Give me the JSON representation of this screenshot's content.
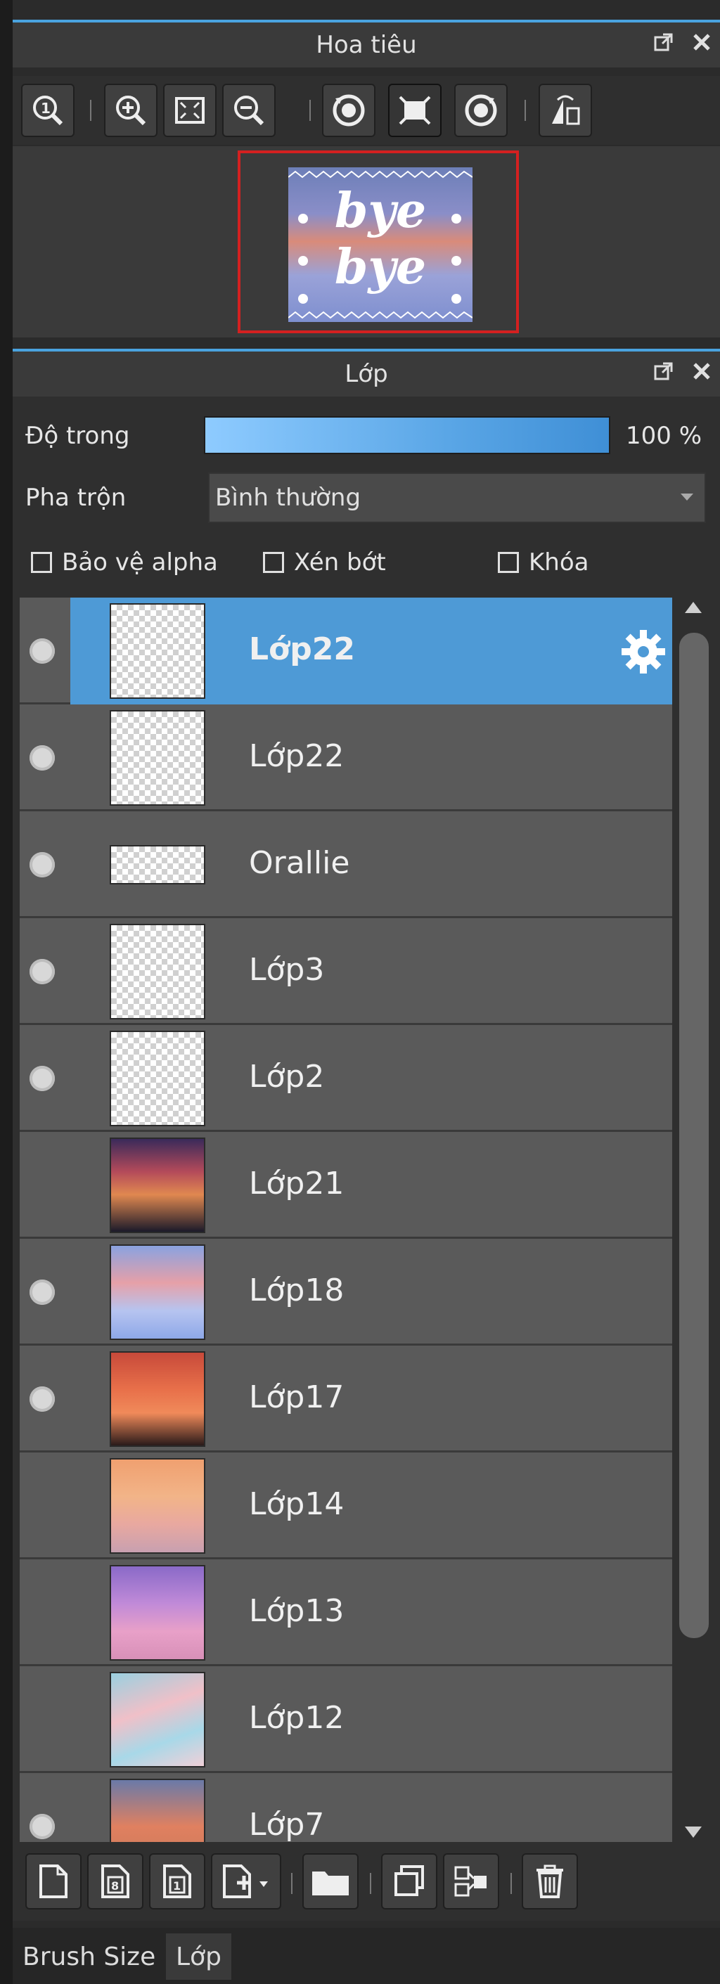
{
  "navigator": {
    "title": "Hoa tiêu",
    "toolbar": [
      {
        "icon": "zoom-actual-icon"
      },
      {
        "icon": "zoom-in-icon"
      },
      {
        "icon": "fit-screen-icon"
      },
      {
        "icon": "zoom-out-icon"
      },
      {
        "icon": "rotate-left-icon"
      },
      {
        "icon": "reset-view-icon"
      },
      {
        "icon": "rotate-right-icon"
      },
      {
        "icon": "flip-horizontal-icon"
      }
    ],
    "preview_text": "bye bye"
  },
  "layer_panel": {
    "title": "Lớp",
    "opacity_label": "Độ trong",
    "opacity_value": "100 %",
    "opacity_fraction": 1.0,
    "blend_label": "Pha trộn",
    "blend_value": "Bình thường",
    "checkboxes": [
      {
        "label": "Bảo vệ alpha",
        "checked": false
      },
      {
        "label": "Xén bớt",
        "checked": false
      },
      {
        "label": "Khóa",
        "checked": false
      }
    ],
    "layers": [
      {
        "name": "Lớp22",
        "visible": true,
        "selected": true,
        "thumb": "checker-text"
      },
      {
        "name": "Lớp22",
        "visible": true,
        "selected": false,
        "thumb": "checker-text"
      },
      {
        "name": "Orallie",
        "visible": true,
        "selected": false,
        "thumb": "checker-strip"
      },
      {
        "name": "Lớp3",
        "visible": true,
        "selected": false,
        "thumb": "checker"
      },
      {
        "name": "Lớp2",
        "visible": true,
        "selected": false,
        "thumb": "checker"
      },
      {
        "name": "Lớp21",
        "visible": false,
        "selected": false,
        "thumb": "sunset-dark"
      },
      {
        "name": "Lớp18",
        "visible": true,
        "selected": false,
        "thumb": "sky-blue"
      },
      {
        "name": "Lớp17",
        "visible": true,
        "selected": false,
        "thumb": "sky-red"
      },
      {
        "name": "Lớp14",
        "visible": false,
        "selected": false,
        "thumb": "sky-orange"
      },
      {
        "name": "Lớp13",
        "visible": false,
        "selected": false,
        "thumb": "sky-purple"
      },
      {
        "name": "Lớp12",
        "visible": false,
        "selected": false,
        "thumb": "sky-teal"
      },
      {
        "name": "Lớp7",
        "visible": true,
        "selected": false,
        "thumb": "sky-cloud"
      }
    ],
    "bottom_toolbar": [
      {
        "icon": "new-layer-icon"
      },
      {
        "icon": "new-8bit-layer-icon"
      },
      {
        "icon": "new-1bit-layer-icon"
      },
      {
        "icon": "add-layer-menu-icon"
      },
      {
        "icon": "new-folder-icon"
      },
      {
        "icon": "duplicate-layer-icon"
      },
      {
        "icon": "merge-down-icon"
      },
      {
        "icon": "delete-layer-icon"
      }
    ]
  },
  "tabs": [
    {
      "label": "Brush Size",
      "active": false
    },
    {
      "label": "Lớp",
      "active": true
    }
  ],
  "colors": {
    "accent": "#4aa3df",
    "selected_row": "#4e9ad6",
    "frame_red": "#d42020"
  }
}
